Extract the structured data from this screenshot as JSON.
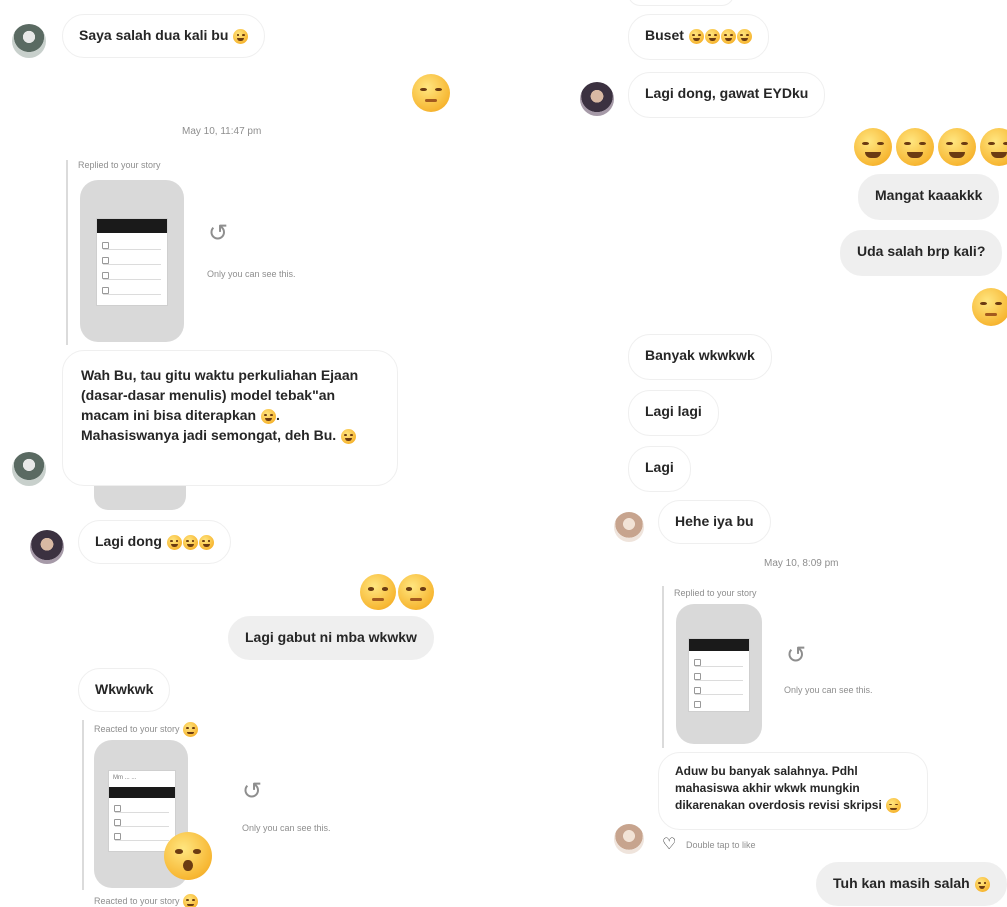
{
  "left": {
    "msg_saya": "Saya salah dua kali bu",
    "ts_1": "May 10, 11:47 pm",
    "replied_1": "Replied to your story",
    "only_1": "Only you can see this.",
    "msg_wah": "Wah Bu, tau gitu waktu perkuliahan Ejaan (dasar-dasar menulis) model tebak\"an macam ini bisa diterapkan",
    "msg_wah_2": "Mahasiswanya jadi semongat, deh Bu.",
    "msg_lagi_dong": "Lagi dong",
    "msg_gabut": "Lagi gabut ni mba wkwkw",
    "msg_wkwkwk": "Wkwkwk",
    "reacted_1": "Reacted to your story",
    "only_2": "Only you can see this.",
    "reacted_2": "Reacted to your story"
  },
  "right": {
    "msg_buset": "Buset",
    "msg_lagi_dong_eyd": "Lagi dong, gawat EYDku",
    "msg_mangat": "Mangat kaaakkk",
    "msg_uda": "Uda salah brp kali?",
    "msg_banyak": "Banyak wkwkwk",
    "msg_lagi_lagi": "Lagi lagi",
    "msg_lagi": "Lagi",
    "msg_hehe": "Hehe iya bu",
    "ts_2": "May 10, 8:09 pm",
    "replied_2": "Replied to your story",
    "only_3": "Only you can see this.",
    "msg_aduw": "Aduw bu banyak salahnya. Pdhl mahasiswa akhir wkwk mungkin dikarenakan overdosis revisi skripsi",
    "double_tap": "Double tap to like",
    "msg_tuh": "Tuh kan masih salah"
  },
  "icons": {
    "clock": "clock-rewind-icon",
    "heart": "heart-outline-icon"
  },
  "colors": {
    "received_bubble": "#ffffff",
    "sent_bubble": "#efefef",
    "muted_text": "#8e8e8e",
    "emoji_yellow": "#f7b733"
  }
}
